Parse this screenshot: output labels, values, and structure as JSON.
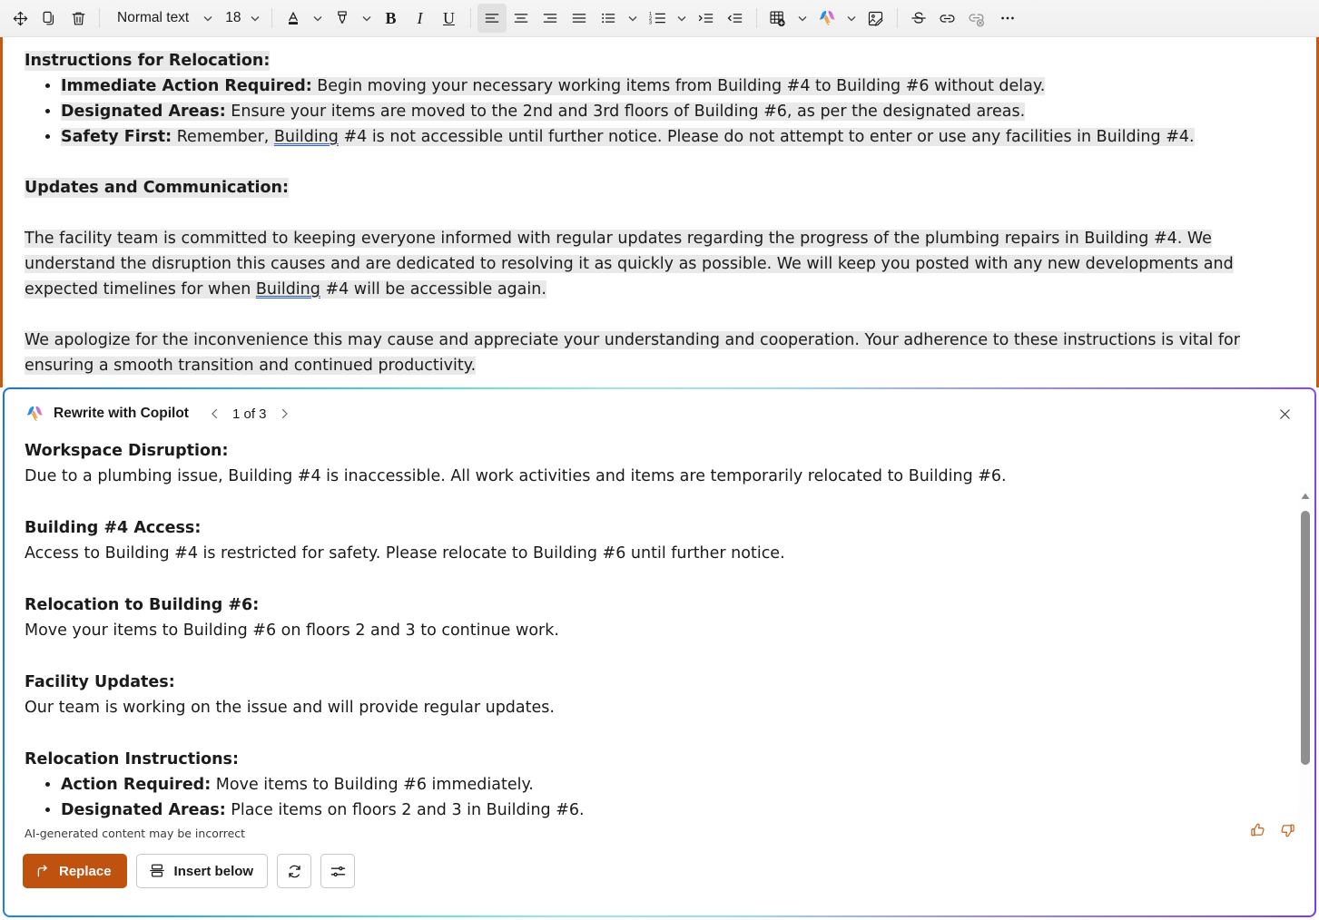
{
  "toolbar": {
    "move_icon": "move-handle-icon",
    "copy_icon": "copy-icon",
    "delete_icon": "trash-icon",
    "style_label": "Normal text",
    "font_size": "18",
    "font_color_icon": "font-color-icon",
    "highlight_icon": "highlighter-icon",
    "bold_label": "B",
    "italic_label": "I",
    "underline_label": "U",
    "align_left_icon": "align-left-icon",
    "align_center_icon": "align-center-icon",
    "align_right_icon": "align-right-icon",
    "align_justify_icon": "align-justify-icon",
    "bullets_icon": "bulleted-list-icon",
    "numbering_icon": "numbered-list-icon",
    "indent_increase_icon": "increase-indent-icon",
    "indent_decrease_icon": "decrease-indent-icon",
    "table_icon": "insert-table-icon",
    "copilot_icon": "copilot-icon",
    "picture_icon": "insert-picture-icon",
    "strikethrough_icon": "strikethrough-icon",
    "link_icon": "insert-link-icon",
    "unlink_icon": "remove-link-icon",
    "overflow_icon": "more-options-icon"
  },
  "document": {
    "heading1": "Instructions for Relocation:",
    "bullets": [
      {
        "bold": "Immediate Action Required:",
        "rest": " Begin moving your necessary working items from Building #4 to Building #6 without delay."
      },
      {
        "bold": "Designated Areas:",
        "rest": " Ensure your items are moved to the 2nd and 3rd floors of Building #6, as per the designated areas."
      },
      {
        "bold": "Safety First:",
        "rest_a": " Remember, ",
        "spell": "Building",
        "rest_b": " #4 is not accessible until further notice. Please do not attempt to enter or use any facilities in Building #4."
      }
    ],
    "heading2": "Updates and Communication:",
    "para1_a": "The facility team is committed to keeping everyone informed with regular updates regarding the progress of the plumbing repairs in Building #4. We understand the disruption this causes and are dedicated to resolving it as quickly as possible. We will keep you posted with any new developments and expected timelines for when ",
    "para1_spell": "Building",
    "para1_b": " #4 will be accessible again.",
    "para2": "We apologize for the inconvenience this may cause and appreciate your understanding and cooperation. Your adherence to these instructions is vital for ensuring a smooth transition and continued productivity."
  },
  "copilot": {
    "title": "Rewrite with Copilot",
    "pager": "1 of 3",
    "prev_icon": "chevron-left-icon",
    "next_icon": "chevron-right-icon",
    "close_icon": "close-icon",
    "logo_icon": "copilot-icon",
    "sections": [
      {
        "heading": "Workspace Disruption:",
        "body": "Due to a plumbing issue, Building #4 is inaccessible. All work activities and items are temporarily relocated to Building #6."
      },
      {
        "heading": "Building #4 Access:",
        "body": "Access to Building #4 is restricted for safety. Please relocate to Building #6 until further notice."
      },
      {
        "heading": "Relocation to Building #6:",
        "body": "Move your items to Building #6 on floors 2 and 3 to continue work."
      },
      {
        "heading": "Facility Updates:",
        "body": "Our team is working on the issue and will provide regular updates."
      }
    ],
    "last_heading": "Relocation Instructions:",
    "last_bullets": [
      {
        "bold": "Action Required:",
        "rest": " Move items to Building #6 immediately."
      },
      {
        "bold": "Designated Areas:",
        "rest": " Place items on floors 2 and 3 in Building #6."
      }
    ],
    "disclaimer": "AI-generated content may be incorrect",
    "thumbs_up_icon": "thumbs-up-icon",
    "thumbs_down_icon": "thumbs-down-icon",
    "replace_label": "Replace",
    "replace_icon": "replace-arrow-icon",
    "insert_below_label": "Insert below",
    "insert_below_icon": "insert-below-icon",
    "regenerate_icon": "regenerate-icon",
    "settings_icon": "tune-sliders-icon",
    "scroll_up_icon": "scroll-up-arrow-icon",
    "scroll_down_icon": "scroll-down-arrow-icon"
  },
  "colors": {
    "accent_orange": "#c0520f",
    "doc_border": "#c55a11",
    "selection": "#e9e9e9",
    "spellcheck": "#2b5fd9"
  }
}
